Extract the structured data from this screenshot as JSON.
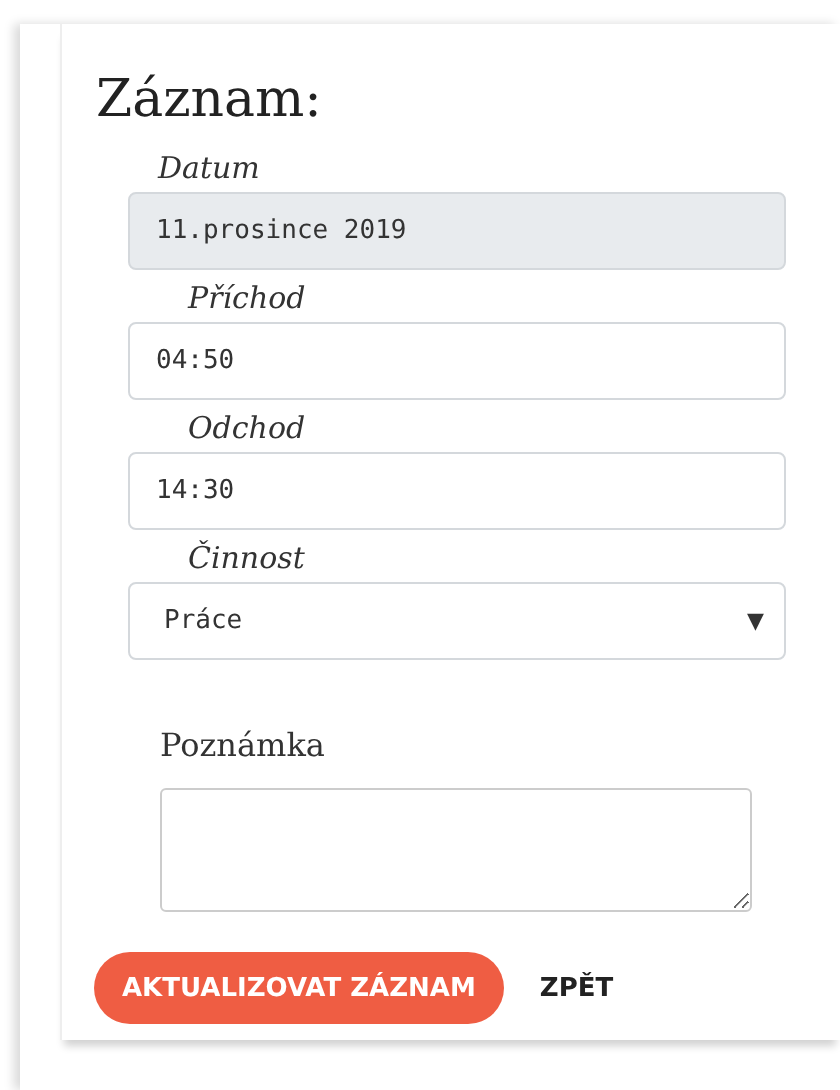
{
  "title": "Záznam:",
  "fields": [
    {
      "kind": "readonly",
      "label": "Datum",
      "value": "11.prosince 2019"
    },
    {
      "kind": "input",
      "label": "Příchod",
      "value": "04:50"
    },
    {
      "kind": "input",
      "label": "Odchod",
      "value": "14:30"
    },
    {
      "kind": "select",
      "label": "Činnost",
      "value": "Práce",
      "arrow": "▼"
    }
  ],
  "note": {
    "label": "Poznámka"
  },
  "buttons": [
    {
      "kind": "primary",
      "label": "AKTUALIZOVAT ZÁZNAM"
    },
    {
      "kind": "link",
      "label": "ZPĚT"
    }
  ]
}
